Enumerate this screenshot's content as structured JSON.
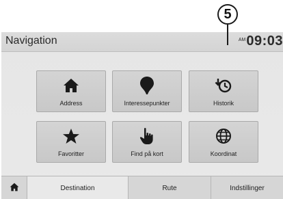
{
  "callout": {
    "number": "5"
  },
  "header": {
    "title": "Navigation",
    "ampm": "AM",
    "time": "09:03"
  },
  "tiles": [
    {
      "label": "Address",
      "icon": "home-icon"
    },
    {
      "label": "Interessepunkter",
      "icon": "map-pin-icon"
    },
    {
      "label": "Historik",
      "icon": "history-icon"
    },
    {
      "label": "Favoritter",
      "icon": "star-icon"
    },
    {
      "label": "Find på kort",
      "icon": "pointing-hand-icon"
    },
    {
      "label": "Koordinat",
      "icon": "globe-icon"
    }
  ],
  "tabs": {
    "home_icon": "home-icon",
    "destination": "Destination",
    "rute": "Rute",
    "settings": "Indstillinger",
    "active": "Destination"
  }
}
